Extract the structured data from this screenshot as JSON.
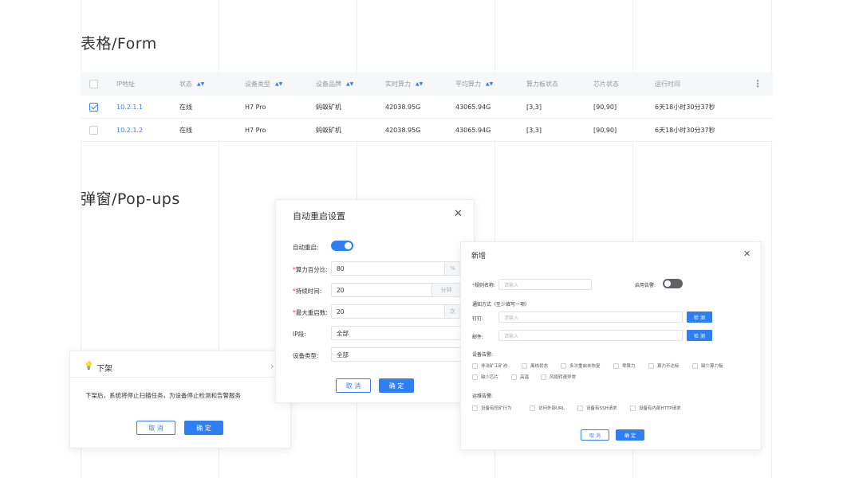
{
  "sections": {
    "form_title": "表格/Form",
    "popups_title": "弹窗/Pop-ups"
  },
  "table": {
    "headers": [
      "IP地址",
      "状态",
      "设备类型",
      "设备品牌",
      "实时算力",
      "平均算力",
      "算力板状态",
      "芯片状态",
      "运行时间"
    ],
    "rows": [
      {
        "checked": true,
        "ip": "10.2.1.1",
        "status": "在线",
        "type": "H7 Pro",
        "brand": "蚂蚁矿机",
        "realtime": "42038.95G",
        "average": "43065.94G",
        "board": "[3,3]",
        "chip": "[90,90]",
        "uptime": "6天18小时30分37秒"
      },
      {
        "checked": false,
        "ip": "10.2.1.2",
        "status": "在线",
        "type": "H7 Pro",
        "brand": "蚂蚁矿机",
        "realtime": "42038.95G",
        "average": "43065.94G",
        "board": "[3,3]",
        "chip": "[90,90]",
        "uptime": "6天18小时30分37秒"
      }
    ]
  },
  "offshelf": {
    "title": "下架",
    "message": "下架后，系统将停止扫描任务，为设备停止检测和告警服务",
    "cancel": "取 消",
    "confirm": "确 定"
  },
  "restart": {
    "title": "自动重启设置",
    "auto_label": "自动重启:",
    "auto_on": true,
    "hash_label": "算力百分比:",
    "hash_value": "80",
    "hash_unit": "%",
    "duration_label": "持续时间:",
    "duration_value": "20",
    "duration_unit": "分钟",
    "max_label": "最大重启数:",
    "max_value": "20",
    "max_unit": "次",
    "ip_label": "IP段:",
    "ip_value": "全部",
    "type_label": "设备类型:",
    "type_value": "全部",
    "cancel": "取 消",
    "confirm": "确 定"
  },
  "add": {
    "title": "新增",
    "rule_label": "规则名称:",
    "rule_placeholder": "请输入",
    "alarm_label": "启用告警:",
    "alarm_on": false,
    "notify_label": "通知方式（至少填写一项）",
    "dingding_label": "钉钉:",
    "dingding_placeholder": "请输入",
    "mail_label": "邮件:",
    "mail_placeholder": "请输入",
    "detect_label": "检 测",
    "device_alarm_label": "设备告警:",
    "device_alarms": [
      "非法矿工矿池",
      "离线状态",
      "多次重启未恢复",
      "零算力",
      "算力不达标",
      "缺少算力板",
      "缺少芯片",
      "高温",
      "风扇转速异常"
    ],
    "ops_alarm_label": "运维告警:",
    "ops_alarms": [
      "设备有挖矿行为",
      "访问外部URL",
      "设备有SSH请求",
      "设备有内部HTTP请求"
    ],
    "cancel": "取 消",
    "confirm": "确 定"
  },
  "colors": {
    "accent": "#2f7ef2",
    "required": "#e4393c",
    "toggle_off": "#5f6266"
  },
  "icons": {
    "tip": "lightbulb-icon",
    "close": "close-icon",
    "more": "more-vertical-icon",
    "sort": "sort-icon",
    "chevron": "chevron-right-icon"
  }
}
